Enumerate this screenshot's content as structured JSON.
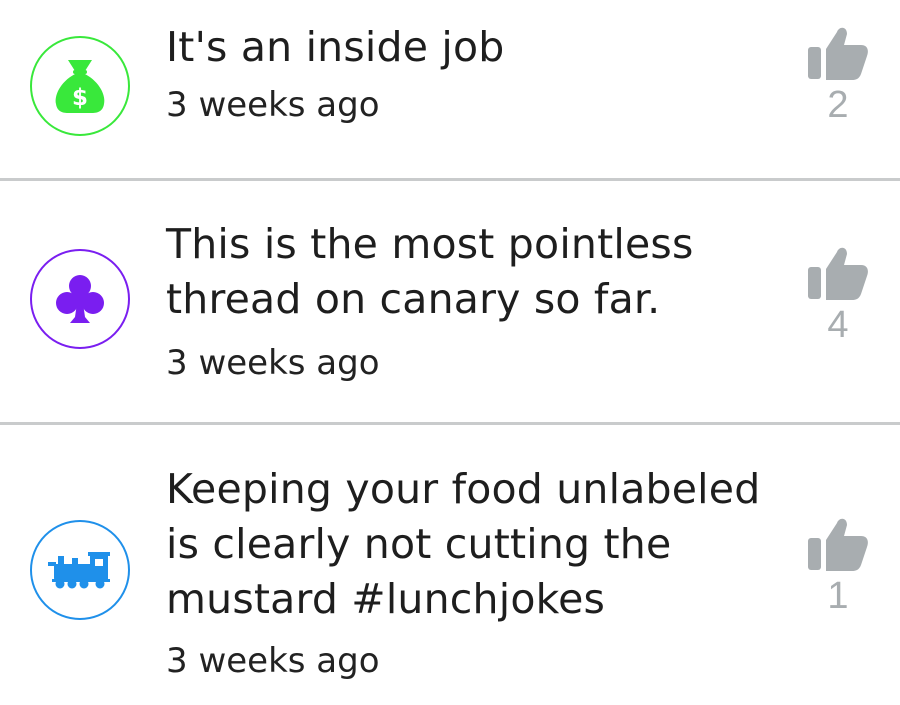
{
  "comments": [
    {
      "avatar_icon": "money-bag-icon",
      "avatar_color": "#39e83b",
      "text": "It's an inside job",
      "time": "3 weeks ago",
      "like_icon": "thumbs-up-icon",
      "likes": "2"
    },
    {
      "avatar_icon": "club-suit-icon",
      "avatar_color": "#7a1ef0",
      "text": "This is the most pointless thread on canary so far.",
      "time": "3 weeks ago",
      "like_icon": "thumbs-up-icon",
      "likes": "4"
    },
    {
      "avatar_icon": "train-icon",
      "avatar_color": "#1f90ea",
      "text": "Keeping your food unlabeled is clearly not cutting the mustard #lunchjokes",
      "time": "3 weeks ago",
      "like_icon": "thumbs-up-icon",
      "likes": "1"
    }
  ],
  "colors": {
    "like_gray": "#a8adb0",
    "divider": "#c9cbcc"
  }
}
